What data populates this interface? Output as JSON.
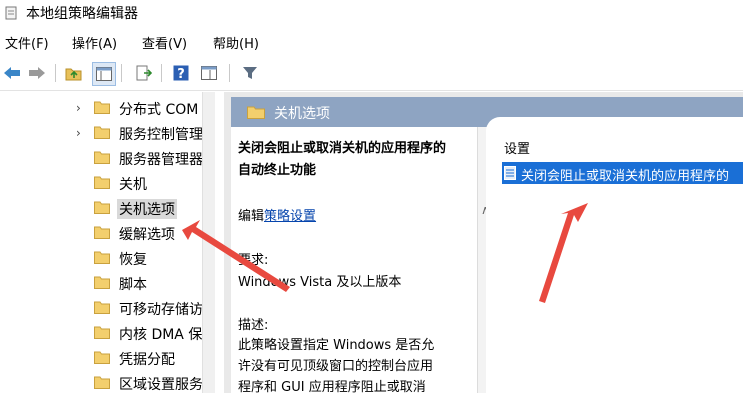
{
  "window": {
    "title": "本地组策略编辑器"
  },
  "menu": [
    "文件(F)",
    "操作(A)",
    "查看(V)",
    "帮助(H)"
  ],
  "toolbar": {
    "icons": [
      "back-arrow-icon",
      "forward-arrow-icon",
      "up-folder-icon",
      "show-hide-tree-icon",
      "export-list-icon",
      "help-icon",
      "properties-icon",
      "filter-icon"
    ]
  },
  "tree": {
    "items": [
      {
        "label": "分布式 COM",
        "has_children": true
      },
      {
        "label": "服务控制管理",
        "has_children": true
      },
      {
        "label": "服务器管理器",
        "has_children": false
      },
      {
        "label": "关机",
        "has_children": false
      },
      {
        "label": "关机选项",
        "has_children": false,
        "selected": true
      },
      {
        "label": "缓解选项",
        "has_children": false
      },
      {
        "label": "恢复",
        "has_children": false
      },
      {
        "label": "脚本",
        "has_children": false
      },
      {
        "label": "可移动存储访",
        "has_children": false
      },
      {
        "label": "内核 DMA 保",
        "has_children": false
      },
      {
        "label": "凭据分配",
        "has_children": false
      },
      {
        "label": "区域设置服务",
        "has_children": false
      }
    ]
  },
  "header": {
    "label": "关机选项"
  },
  "description": {
    "title_line1": "关闭会阻止或取消关机的应用程序的",
    "title_line2": "自动终止功能",
    "edit_prefix": "编辑",
    "edit_link": "策略设置",
    "req_label": "要求:",
    "req_value": "Windows Vista 及以上版本",
    "desc_label": "描述:",
    "desc_line1": "此策略设置指定 Windows 是否允",
    "desc_line2": "许没有可见顶级窗口的控制台应用",
    "desc_line3": "程序和 GUI 应用程序阻止或取消"
  },
  "list": {
    "column_header": "设置",
    "selected_row": "关闭会阻止或取消关机的应用程序的"
  },
  "colors": {
    "header_bar": "#8ea4c2",
    "selection": "#1a6fd6",
    "annotation_arrow": "#e8493f"
  }
}
